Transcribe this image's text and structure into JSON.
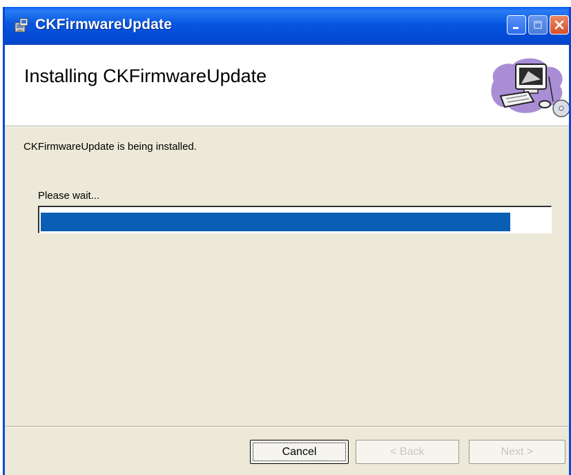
{
  "window": {
    "title": "CKFirmwareUpdate",
    "controls": [
      "minimize-icon",
      "maximize-icon",
      "close-icon"
    ]
  },
  "header": {
    "title": "Installing CKFirmwareUpdate",
    "art_icon": "computer-install-icon"
  },
  "body": {
    "status": "CKFirmwareUpdate is being installed.",
    "wait_label": "Please wait...",
    "progress_fraction": 0.92
  },
  "buttons": {
    "cancel": "Cancel",
    "back": "< Back",
    "next": "Next >"
  },
  "colors": {
    "titlebar": "#0756e0",
    "progress": "#0a5fb4",
    "background": "#ece9d8"
  }
}
